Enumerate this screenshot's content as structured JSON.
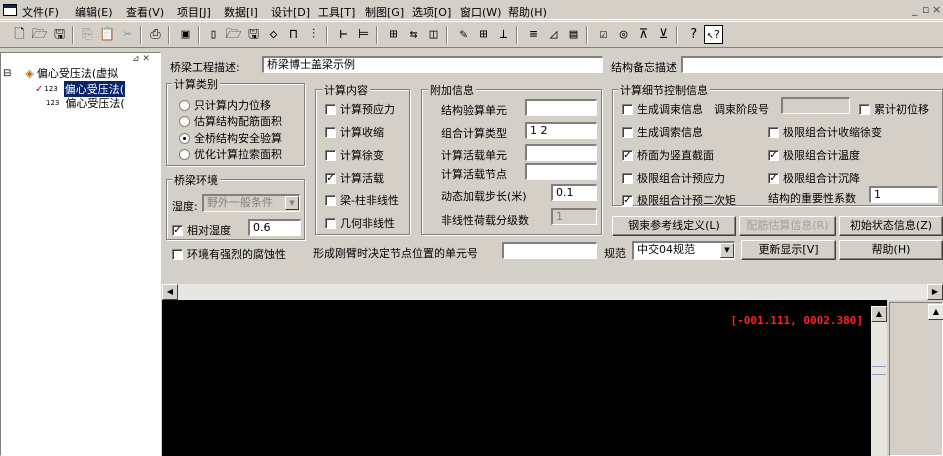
{
  "menu": {
    "items": [
      "文件(F)",
      "编辑(E)",
      "查看(V)",
      "项目[J]",
      "数据[I]",
      "设计[D]",
      "工具[T]",
      "制图[G]",
      "选项[O]",
      "窗口(W)",
      "帮助(H)"
    ],
    "window_controls": [
      "_",
      "▫",
      "×"
    ]
  },
  "tree": {
    "root": "偏心受压法(虚拟",
    "items": [
      "偏心受压法(",
      "偏心受压法("
    ],
    "item_badge": "123",
    "collapse_glyph": "⊟"
  },
  "header": {
    "project_desc_label": "桥梁工程描述:",
    "project_desc_value": "桥梁博士盖梁示例",
    "memo_label": "结构备忘描述",
    "memo_value": ""
  },
  "calc_type": {
    "title": "计算类别",
    "options": [
      "只计算内力位移",
      "估算结构配筋面积",
      "全桥结构安全验算",
      "优化计算拉索面积"
    ],
    "selected": 2
  },
  "environment": {
    "title": "桥梁环境",
    "humidity_label": "湿度:",
    "humidity_value": "野外一般条件",
    "relative_humidity_label": "相对湿度",
    "relative_humidity_value": "0.6",
    "relative_humidity_checked": true,
    "corrosion_label": "环境有强烈的腐蚀性",
    "corrosion_checked": false
  },
  "calc_content": {
    "title": "计算内容",
    "items": [
      {
        "label": "计算预应力",
        "checked": false
      },
      {
        "label": "计算收缩",
        "checked": false
      },
      {
        "label": "计算徐变",
        "checked": false
      },
      {
        "label": "计算活载",
        "checked": true
      },
      {
        "label": "梁-柱非线性",
        "checked": false
      },
      {
        "label": "几何非线性",
        "checked": false
      }
    ]
  },
  "extra_info": {
    "title": "附加信息",
    "rows": [
      {
        "label": "结构验算单元",
        "value": ""
      },
      {
        "label": "组合计算类型",
        "value": "1 2"
      },
      {
        "label": "计算活载单元",
        "value": ""
      },
      {
        "label": "计算活载节点",
        "value": ""
      },
      {
        "label": "动态加载步长(米)",
        "value": "0.1"
      },
      {
        "label": "非线性荷载分级数",
        "value": "1"
      }
    ]
  },
  "detail_control": {
    "title": "计算细节控制信息",
    "gen_adjust_label": "生成调束信息",
    "adjust_stage_label": "调束阶段号",
    "adjust_stage_value": "",
    "cumulative_label": "累计初位移",
    "gen_cable_label": "生成调索信息",
    "limit_shrink_label": "极限组合计收缩徐变",
    "vertical_section_label": "桥面为竖直截面",
    "limit_temp_label": "极限组合计温度",
    "limit_prestress_label": "极限组合计预应力",
    "limit_settle_label": "极限组合计沉降",
    "limit_second_label": "极限组合计预二次矩",
    "importance_label": "结构的重要性系数",
    "importance_value": "1",
    "checks": {
      "gen_adjust": false,
      "cumulative": false,
      "gen_cable": false,
      "limit_shrink": false,
      "vertical_section": true,
      "limit_temp": true,
      "limit_prestress": false,
      "limit_settle": true,
      "limit_second": true
    }
  },
  "buttons": {
    "steel_ref": "钢束参考线定义(L)",
    "rebar_est": "配筋估算信息(R)",
    "init_state": "初始状态信息(Z)",
    "refresh": "更新显示[V]",
    "help": "帮助(H)"
  },
  "bottom": {
    "node_label": "形成刚臂时决定节点位置的单元号",
    "node_value": "",
    "code_label": "规范",
    "code_value": "中交04规范"
  },
  "console": {
    "coord": "[-001.111, 0002.380]"
  },
  "colors": {
    "selection": "#0a246a",
    "console_bg": "#000000",
    "coord_text": "#ff2020"
  }
}
